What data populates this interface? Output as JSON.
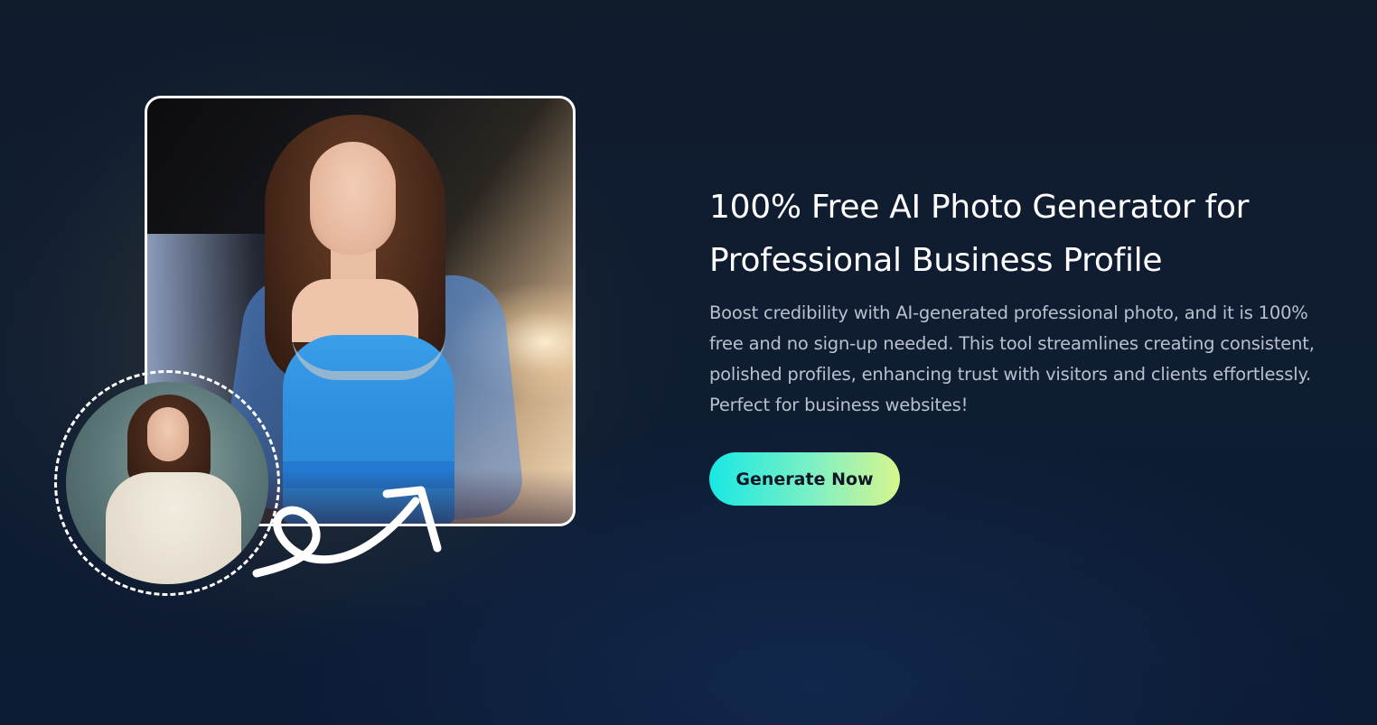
{
  "hero": {
    "title_line1": "100% Free AI Photo Generator for",
    "title_line2": "Professional Business Profile",
    "description": "Boost credibility with AI-generated professional photo, and it is 100% free and no sign-up needed. This tool streamlines creating consistent, polished profiles, enhancing trust with visitors and clients effortlessly. Perfect for business websites!",
    "cta_label": "Generate Now"
  },
  "colors": {
    "background": "#101b2c",
    "cta_gradient_start": "#18e8e3",
    "cta_gradient_end": "#d8f58d",
    "title": "#ffffff",
    "body_text": "#b8c0cd"
  },
  "images": {
    "main_photo": "generated-portrait-woman-blue-gown",
    "inset_photo": "original-portrait-woman-cream-sweater",
    "connector": "swoosh-arrow-icon"
  }
}
